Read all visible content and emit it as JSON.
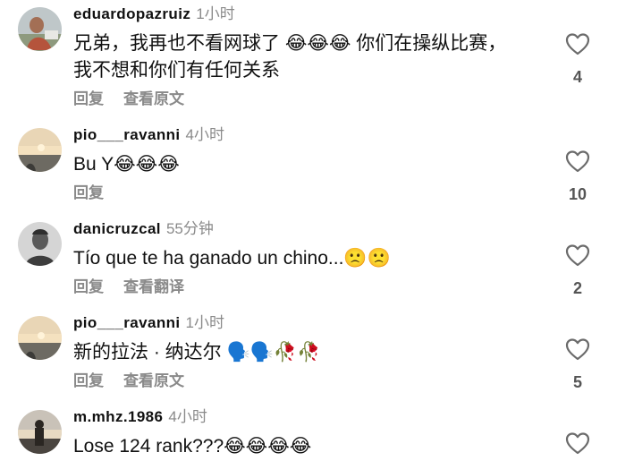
{
  "comments": [
    {
      "username": "eduardopazruiz",
      "time": "1小时",
      "text": "兄弟，我再也不看网球了 😂😂😂 你们在操纵比赛，\n我不想和你们有任何关系",
      "reply_label": "回复",
      "translate_label": "查看原文",
      "likes": "4",
      "avatar": "avatar-person-outdoors"
    },
    {
      "username": "pio___ravanni",
      "time": "4小时",
      "text": "Bu Y😂😂😂",
      "reply_label": "回复",
      "translate_label": "",
      "likes": "10",
      "avatar": "avatar-sunset-lake"
    },
    {
      "username": "danicruzcal",
      "time": "55分钟",
      "text": "Tío que te ha ganado un chino...🙁🙁",
      "reply_label": "回复",
      "translate_label": "查看翻译",
      "likes": "2",
      "avatar": "avatar-man-bw"
    },
    {
      "username": "pio___ravanni",
      "time": "1小时",
      "text": "新的拉法 · 纳达尔 🗣️🗣️🥀🥀",
      "reply_label": "回复",
      "translate_label": "查看原文",
      "likes": "5",
      "avatar": "avatar-sunset-lake"
    },
    {
      "username": "m.mhz.1986",
      "time": "4小时",
      "text": "Lose 124 rank???😂😂😂😂",
      "reply_label": "",
      "translate_label": "",
      "likes": "",
      "avatar": "avatar-silhouette-sunset"
    }
  ],
  "colors": {
    "text": "#111111",
    "secondary": "#8a8a8a",
    "heart_stroke": "#6b6b6b"
  }
}
